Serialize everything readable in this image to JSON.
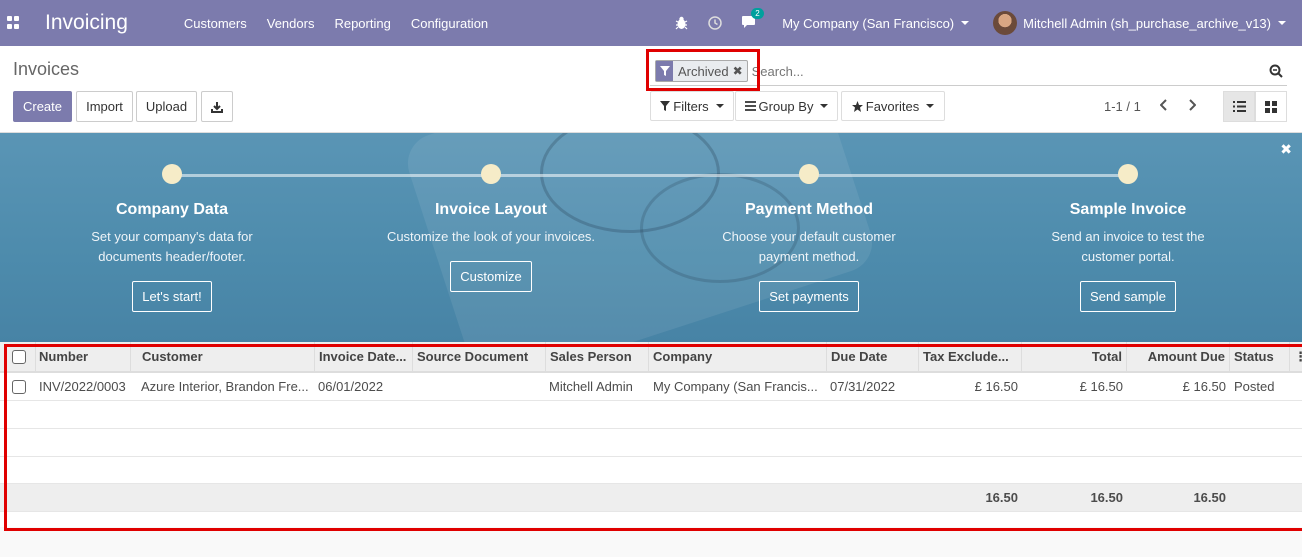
{
  "nav": {
    "brand": "Invoicing",
    "menu": [
      "Customers",
      "Vendors",
      "Reporting",
      "Configuration"
    ],
    "chat_badge": "2",
    "company": "My Company (San Francisco)",
    "user": "Mitchell Admin (sh_purchase_archive_v13)"
  },
  "control_panel": {
    "title": "Invoices",
    "create": "Create",
    "import": "Import",
    "upload": "Upload",
    "facet": "Archived",
    "search_placeholder": "Search...",
    "filters": "Filters",
    "group_by": "Group By",
    "favorites": "Favorites",
    "pager": "1-1 / 1"
  },
  "onboarding": {
    "steps": [
      {
        "title": "Company Data",
        "desc1": "Set your company's data for",
        "desc2": "documents header/footer.",
        "button": "Let's start!"
      },
      {
        "title": "Invoice Layout",
        "desc1": "Customize the look of your invoices.",
        "desc2": "",
        "button": "Customize"
      },
      {
        "title": "Payment Method",
        "desc1": "Choose your default customer",
        "desc2": "payment method.",
        "button": "Set payments"
      },
      {
        "title": "Sample Invoice",
        "desc1": "Send an invoice to test the",
        "desc2": "customer portal.",
        "button": "Send sample"
      }
    ]
  },
  "table": {
    "headers": [
      "Number",
      "Customer",
      "Invoice Date...",
      "Source Document",
      "Sales Person",
      "Company",
      "Due Date",
      "Tax Exclude...",
      "Total",
      "Amount Due",
      "Status"
    ],
    "rows": [
      [
        "INV/2022/0003",
        "Azure Interior, Brandon Fre...",
        "06/01/2022",
        "",
        "Mitchell Admin",
        "My Company (San Francis...",
        "07/31/2022",
        "£ 16.50",
        "£ 16.50",
        "£ 16.50",
        "Posted"
      ]
    ],
    "totals": {
      "tax_excluded": "16.50",
      "total": "16.50",
      "amount_due": "16.50"
    }
  }
}
